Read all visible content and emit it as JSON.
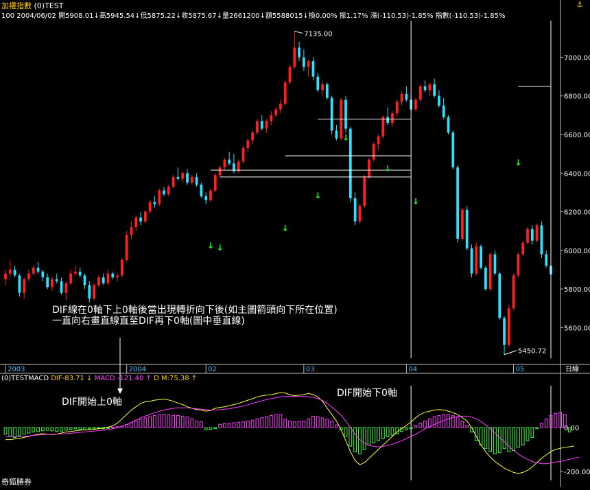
{
  "header": {
    "title": "加權指數",
    "code": "(0)TEST",
    "stats": "100 2004/06/02 開5908.01↓高5945.54↓低5875.22↓收5875.67↓量2661200↓額5588015↓換0.00% 振1.17% 漲(-110.53)-1.85% 指數(-110.53)-1.85%"
  },
  "macd_header": {
    "name": "(0)TESTMACD",
    "dif": "DIF-83.71 ↓",
    "macd": "MACD -121.40 ↑",
    "d": "D",
    "m": "M:75.38 ↑"
  },
  "annotations": {
    "note_line1": "DIF線在0軸下上0軸後當出現轉折向下後(如主圖箭頭向下所在位置)",
    "note_line2": "一直向右畫直線直至DIF再下0軸(圖中垂直線)",
    "dif_up": "DIF開始上0軸",
    "dif_down": "DIF開始下0軸",
    "high_label": "7135.00",
    "low_label": "5450.72"
  },
  "footer": {
    "brand": "奇狐勝券",
    "period": "日線"
  },
  "colors": {
    "up": "#ff2020",
    "down": "#30e0ff",
    "arrow": "#20ff20",
    "dif": "#ffff40",
    "macd": "#ff40ff",
    "hist_pos": "#ff40ff",
    "hist_neg": "#40ff40"
  },
  "chart_data": {
    "type": "candlestick",
    "price_axis": {
      "ticks": [
        5600,
        5800,
        6000,
        6200,
        6400,
        6600,
        6800,
        7000
      ],
      "labels": [
        "5600.00",
        "5800.00",
        "6000.00",
        "6200.00",
        "6400.00",
        "6600.00",
        "6800.00",
        "7000.00"
      ],
      "ylim": [
        5420,
        7190
      ]
    },
    "x_labels": [
      "2003",
      "2004",
      "02",
      "03",
      "04",
      "05"
    ],
    "macd_axis": {
      "ticks": [
        0,
        -200
      ],
      "labels": [
        "0.00",
        "-200.00"
      ],
      "ylim": [
        -260,
        210
      ]
    },
    "candles": [
      [
        5850,
        5900,
        5820,
        5880
      ],
      [
        5880,
        5950,
        5860,
        5900
      ],
      [
        5900,
        5920,
        5860,
        5870
      ],
      [
        5870,
        5880,
        5760,
        5780
      ],
      [
        5780,
        5860,
        5750,
        5850
      ],
      [
        5850,
        5900,
        5840,
        5880
      ],
      [
        5880,
        5920,
        5870,
        5910
      ],
      [
        5910,
        5940,
        5880,
        5890
      ],
      [
        5890,
        5900,
        5840,
        5860
      ],
      [
        5860,
        5880,
        5800,
        5810
      ],
      [
        5810,
        5860,
        5790,
        5850
      ],
      [
        5850,
        5880,
        5830,
        5840
      ],
      [
        5840,
        5860,
        5770,
        5780
      ],
      [
        5780,
        5840,
        5740,
        5830
      ],
      [
        5830,
        5900,
        5820,
        5880
      ],
      [
        5880,
        5920,
        5870,
        5890
      ],
      [
        5890,
        5910,
        5860,
        5870
      ],
      [
        5870,
        5880,
        5800,
        5820
      ],
      [
        5820,
        5840,
        5730,
        5750
      ],
      [
        5750,
        5830,
        5740,
        5820
      ],
      [
        5820,
        5870,
        5810,
        5860
      ],
      [
        5860,
        5880,
        5820,
        5830
      ],
      [
        5830,
        5900,
        5820,
        5880
      ],
      [
        5880,
        5890,
        5850,
        5860
      ],
      [
        5860,
        5880,
        5840,
        5870
      ],
      [
        5870,
        5960,
        5860,
        5950
      ],
      [
        5950,
        6100,
        5940,
        6080
      ],
      [
        6080,
        6150,
        6060,
        6120
      ],
      [
        6120,
        6180,
        6100,
        6170
      ],
      [
        6170,
        6200,
        6130,
        6150
      ],
      [
        6150,
        6210,
        6140,
        6200
      ],
      [
        6200,
        6260,
        6190,
        6250
      ],
      [
        6250,
        6280,
        6220,
        6240
      ],
      [
        6240,
        6320,
        6230,
        6310
      ],
      [
        6310,
        6330,
        6280,
        6290
      ],
      [
        6290,
        6340,
        6280,
        6330
      ],
      [
        6330,
        6390,
        6320,
        6380
      ],
      [
        6380,
        6430,
        6360,
        6370
      ],
      [
        6370,
        6410,
        6350,
        6400
      ],
      [
        6400,
        6420,
        6340,
        6350
      ],
      [
        6350,
        6390,
        6340,
        6380
      ],
      [
        6380,
        6400,
        6330,
        6340
      ],
      [
        6340,
        6350,
        6270,
        6280
      ],
      [
        6280,
        6300,
        6240,
        6260
      ],
      [
        6260,
        6320,
        6250,
        6310
      ],
      [
        6310,
        6400,
        6300,
        6390
      ],
      [
        6390,
        6440,
        6380,
        6430
      ],
      [
        6430,
        6480,
        6420,
        6470
      ],
      [
        6470,
        6510,
        6440,
        6450
      ],
      [
        6450,
        6500,
        6400,
        6410
      ],
      [
        6410,
        6470,
        6400,
        6460
      ],
      [
        6460,
        6540,
        6450,
        6530
      ],
      [
        6530,
        6580,
        6510,
        6570
      ],
      [
        6570,
        6620,
        6550,
        6610
      ],
      [
        6610,
        6680,
        6600,
        6670
      ],
      [
        6670,
        6700,
        6620,
        6630
      ],
      [
        6630,
        6680,
        6610,
        6670
      ],
      [
        6670,
        6720,
        6650,
        6700
      ],
      [
        6700,
        6740,
        6690,
        6730
      ],
      [
        6730,
        6780,
        6710,
        6760
      ],
      [
        6760,
        6880,
        6750,
        6870
      ],
      [
        6870,
        6960,
        6860,
        6950
      ],
      [
        6950,
        7135,
        6940,
        7050
      ],
      [
        7050,
        7080,
        6980,
        7000
      ],
      [
        7000,
        7040,
        6930,
        6950
      ],
      [
        6950,
        6990,
        6900,
        6980
      ],
      [
        6980,
        7000,
        6880,
        6900
      ],
      [
        6900,
        6920,
        6820,
        6830
      ],
      [
        6830,
        6880,
        6800,
        6860
      ],
      [
        6860,
        6870,
        6780,
        6790
      ],
      [
        6790,
        6800,
        6600,
        6620
      ],
      [
        6620,
        6650,
        6570,
        6580
      ],
      [
        6580,
        6790,
        6570,
        6780
      ],
      [
        6780,
        6800,
        6610,
        6630
      ],
      [
        6630,
        6640,
        6250,
        6270
      ],
      [
        6270,
        6300,
        6130,
        6150
      ],
      [
        6150,
        6240,
        6140,
        6230
      ],
      [
        6230,
        6390,
        6220,
        6380
      ],
      [
        6380,
        6480,
        6370,
        6470
      ],
      [
        6470,
        6560,
        6460,
        6550
      ],
      [
        6550,
        6600,
        6520,
        6590
      ],
      [
        6590,
        6700,
        6580,
        6690
      ],
      [
        6690,
        6740,
        6650,
        6660
      ],
      [
        6660,
        6720,
        6640,
        6710
      ],
      [
        6710,
        6780,
        6690,
        6770
      ],
      [
        6770,
        6820,
        6750,
        6810
      ],
      [
        6810,
        6850,
        6770,
        6780
      ],
      [
        6780,
        6800,
        6720,
        6730
      ],
      [
        6730,
        6790,
        6720,
        6780
      ],
      [
        6780,
        6860,
        6770,
        6850
      ],
      [
        6850,
        6880,
        6820,
        6830
      ],
      [
        6830,
        6870,
        6800,
        6860
      ],
      [
        6860,
        6890,
        6790,
        6800
      ],
      [
        6800,
        6830,
        6740,
        6750
      ],
      [
        6750,
        6790,
        6680,
        6690
      ],
      [
        6690,
        6700,
        6600,
        6610
      ],
      [
        6610,
        6620,
        6420,
        6430
      ],
      [
        6430,
        6440,
        6040,
        6060
      ],
      [
        6060,
        6220,
        6050,
        6210
      ],
      [
        6210,
        6230,
        6000,
        6010
      ],
      [
        6010,
        6030,
        5860,
        5880
      ],
      [
        5880,
        6040,
        5870,
        6020
      ],
      [
        6020,
        6030,
        5900,
        5910
      ],
      [
        5910,
        5920,
        5790,
        5800
      ],
      [
        5800,
        5990,
        5790,
        5980
      ],
      [
        5980,
        6000,
        5870,
        5880
      ],
      [
        5880,
        5890,
        5640,
        5650
      ],
      [
        5650,
        5660,
        5460,
        5510
      ],
      [
        5510,
        5720,
        5500,
        5700
      ],
      [
        5700,
        5880,
        5690,
        5870
      ],
      [
        5870,
        5990,
        5860,
        5980
      ],
      [
        5980,
        6050,
        5970,
        6040
      ],
      [
        6040,
        6120,
        6030,
        6110
      ],
      [
        6110,
        6130,
        6030,
        6050
      ],
      [
        6050,
        6140,
        6040,
        6130
      ],
      [
        6130,
        6150,
        5960,
        5980
      ],
      [
        5980,
        6000,
        5910,
        5920
      ],
      [
        5920,
        5940,
        5875,
        5876
      ]
    ],
    "down_arrows": [
      {
        "i": 44,
        "price": 6010
      },
      {
        "i": 46,
        "price": 6000
      },
      {
        "i": 60,
        "price": 6100
      },
      {
        "i": 67,
        "price": 6270
      },
      {
        "i": 73,
        "price": 6570
      },
      {
        "i": 82,
        "price": 6410
      },
      {
        "i": 88,
        "price": 6240
      },
      {
        "i": 110,
        "price": 6440
      }
    ],
    "horizontal_segments": [
      {
        "i0": 44,
        "i1": 87,
        "price": 6415
      },
      {
        "i0": 46,
        "i1": 87,
        "price": 6380
      },
      {
        "i0": 60,
        "i1": 87,
        "price": 6490
      },
      {
        "i0": 67,
        "i1": 87,
        "price": 6680
      },
      {
        "i0": 110,
        "i1": 117,
        "price": 6850
      }
    ],
    "vertical_markers": [
      87,
      117
    ],
    "macd_hist": [
      -30,
      -40,
      -45,
      -38,
      -30,
      -25,
      -20,
      -18,
      -15,
      -12,
      -15,
      -18,
      -16,
      -12,
      -8,
      -6,
      -8,
      -10,
      -6,
      -4,
      -2,
      -6,
      -4,
      2,
      4,
      6,
      14,
      22,
      30,
      38,
      44,
      50,
      55,
      58,
      60,
      58,
      56,
      55,
      52,
      48,
      40,
      30,
      26,
      -10,
      -8,
      -5,
      15,
      18,
      20,
      22,
      24,
      26,
      30,
      34,
      40,
      45,
      50,
      55,
      58,
      60,
      38,
      30,
      26,
      28,
      30,
      40,
      52,
      50,
      44,
      38,
      30,
      12,
      -10,
      -40,
      -85,
      -110,
      -120,
      -100,
      -80,
      -70,
      -60,
      -50,
      -42,
      -35,
      -28,
      -18,
      -10,
      -5,
      10,
      20,
      30,
      40,
      50,
      55,
      60,
      58,
      54,
      48,
      30,
      10,
      -20,
      -60,
      -80,
      -95,
      -110,
      -120,
      -115,
      -95,
      -110,
      -105,
      -90,
      -80,
      -60,
      -45,
      -5,
      20,
      40,
      55,
      65,
      70,
      60,
      -20
    ],
    "dif": [
      -55,
      -55,
      -52,
      -50,
      -45,
      -40,
      -35,
      -30,
      -28,
      -30,
      -32,
      -30,
      -25,
      -20,
      -18,
      -15,
      -12,
      -10,
      -10,
      -8,
      -5,
      -2,
      2,
      8,
      20,
      40,
      60,
      80,
      95,
      110,
      118,
      120,
      125,
      128,
      130,
      126,
      120,
      112,
      105,
      95,
      88,
      82,
      80,
      75,
      78,
      88,
      92,
      95,
      100,
      105,
      110,
      118,
      125,
      132,
      140,
      145,
      148,
      150,
      155,
      160,
      158,
      150,
      145,
      148,
      150,
      156,
      150,
      140,
      120,
      90,
      60,
      30,
      -10,
      -60,
      -110,
      -150,
      -170,
      -160,
      -140,
      -120,
      -100,
      -80,
      -60,
      -40,
      -20,
      -5,
      10,
      25,
      45,
      60,
      70,
      75,
      80,
      82,
      80,
      75,
      68,
      60,
      45,
      30,
      0,
      -40,
      -80,
      -110,
      -135,
      -155,
      -170,
      -185,
      -195,
      -205,
      -210,
      -205,
      -195,
      -180,
      -160,
      -140,
      -125,
      -110,
      -100,
      -95,
      -90,
      -88,
      -84
    ],
    "macd": [
      -40,
      -42,
      -42,
      -41,
      -40,
      -38,
      -36,
      -34,
      -32,
      -31,
      -30,
      -30,
      -29,
      -28,
      -26,
      -24,
      -22,
      -20,
      -18,
      -16,
      -14,
      -12,
      -10,
      -6,
      0,
      6,
      14,
      24,
      34,
      44,
      52,
      60,
      68,
      74,
      80,
      84,
      88,
      90,
      90,
      90,
      88,
      86,
      84,
      82,
      80,
      80,
      82,
      84,
      86,
      90,
      94,
      98,
      104,
      110,
      116,
      122,
      128,
      132,
      136,
      140,
      142,
      142,
      142,
      142,
      142,
      140,
      138,
      132,
      124,
      110,
      94,
      76,
      56,
      30,
      0,
      -30,
      -55,
      -70,
      -80,
      -86,
      -88,
      -86,
      -82,
      -76,
      -68,
      -60,
      -50,
      -40,
      -30,
      -18,
      -6,
      4,
      14,
      24,
      32,
      40,
      46,
      50,
      52,
      52,
      48,
      40,
      28,
      12,
      -5,
      -25,
      -45,
      -65,
      -85,
      -105,
      -120,
      -135,
      -145,
      -155,
      -160,
      -165,
      -165,
      -162,
      -158,
      -155,
      -150,
      -145,
      -140,
      -135
    ]
  }
}
